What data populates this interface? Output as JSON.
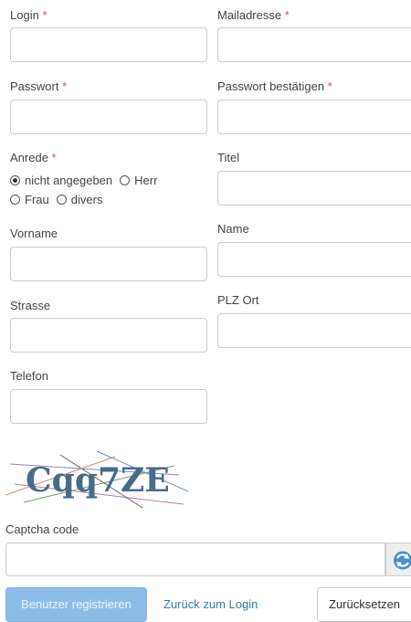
{
  "form": {
    "login": {
      "label": "Login",
      "required": "*",
      "value": ""
    },
    "mail": {
      "label": "Mailadresse",
      "required": "*",
      "value": ""
    },
    "password": {
      "label": "Passwort",
      "required": "*",
      "value": ""
    },
    "password_confirm": {
      "label": "Passwort bestätigen",
      "required": "*",
      "value": ""
    },
    "salutation": {
      "label": "Anrede",
      "required": "*",
      "options": [
        "nicht angegeben",
        "Herr",
        "Frau",
        "divers"
      ],
      "selected": "nicht angegeben"
    },
    "title": {
      "label": "Titel",
      "value": ""
    },
    "firstname": {
      "label": "Vorname",
      "value": ""
    },
    "lastname": {
      "label": "Name",
      "value": ""
    },
    "street": {
      "label": "Strasse",
      "value": ""
    },
    "zip_city": {
      "label": "PLZ Ort",
      "value": ""
    },
    "phone": {
      "label": "Telefon",
      "value": ""
    },
    "captcha": {
      "label": "Captcha code",
      "image_text": "Cqq7ZE",
      "value": "",
      "refresh_icon": "refresh-icon"
    }
  },
  "actions": {
    "register": "Benutzer registrieren",
    "back_to_login": "Zurück zum Login",
    "reset": "Zurücksetzen"
  },
  "colors": {
    "required": "#d9534f",
    "primary_button": "#8dbde6",
    "link": "#337ab7",
    "border": "#cccccc"
  }
}
